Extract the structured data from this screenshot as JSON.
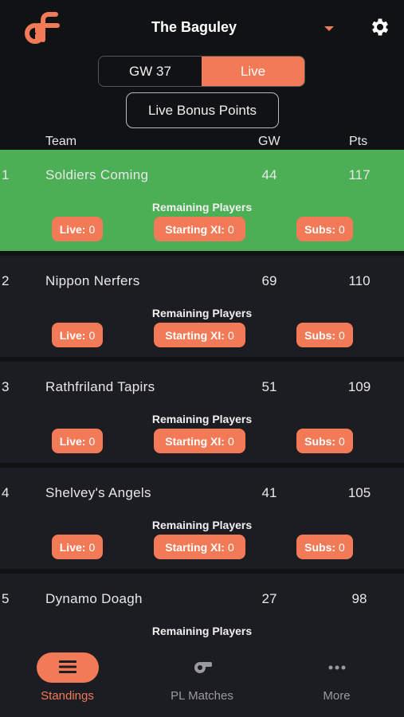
{
  "header": {
    "title": "The Baguley",
    "accent_color": "#f27a56",
    "icons": {
      "logo": "df-logo",
      "dropdown": "caret-down-icon",
      "settings": "gear-icon"
    }
  },
  "toggle": {
    "gameweek_label": "GW 37",
    "live_label": "Live",
    "selected": "Live",
    "bonus_button": "Live Bonus Points"
  },
  "columns": {
    "team": "Team",
    "gw": "GW",
    "pts": "Pts"
  },
  "standings": [
    {
      "rank": "1",
      "team": "Soldiers Coming",
      "gw": "44",
      "pts": "117",
      "remaining_label": "Remaining Players",
      "live_label": "Live:",
      "live_value": "0",
      "xi_label": "Starting XI:",
      "xi_value": "0",
      "subs_label": "Subs:",
      "subs_value": "0",
      "highlighted": true
    },
    {
      "rank": "2",
      "team": "Nippon Nerfers",
      "gw": "69",
      "pts": "110",
      "remaining_label": "Remaining Players",
      "live_label": "Live:",
      "live_value": "0",
      "xi_label": "Starting XI:",
      "xi_value": "0",
      "subs_label": "Subs:",
      "subs_value": "0"
    },
    {
      "rank": "3",
      "team": "Rathfriland Tapirs",
      "gw": "51",
      "pts": "109",
      "remaining_label": "Remaining Players",
      "live_label": "Live:",
      "live_value": "0",
      "xi_label": "Starting XI:",
      "xi_value": "0",
      "subs_label": "Subs:",
      "subs_value": "0"
    },
    {
      "rank": "4",
      "team": "Shelvey's Angels",
      "gw": "41",
      "pts": "105",
      "remaining_label": "Remaining Players",
      "live_label": "Live:",
      "live_value": "0",
      "xi_label": "Starting XI:",
      "xi_value": "0",
      "subs_label": "Subs:",
      "subs_value": "0"
    },
    {
      "rank": "5",
      "team": "Dynamo Doagh",
      "gw": "27",
      "pts": "98",
      "remaining_label": "Remaining Players"
    }
  ],
  "tabbar": {
    "tabs": [
      {
        "label": "Standings",
        "icon": "list-icon",
        "active": true
      },
      {
        "label": "PL Matches",
        "icon": "whistle-icon"
      },
      {
        "label": "More",
        "icon": "more-dots-icon"
      }
    ]
  }
}
